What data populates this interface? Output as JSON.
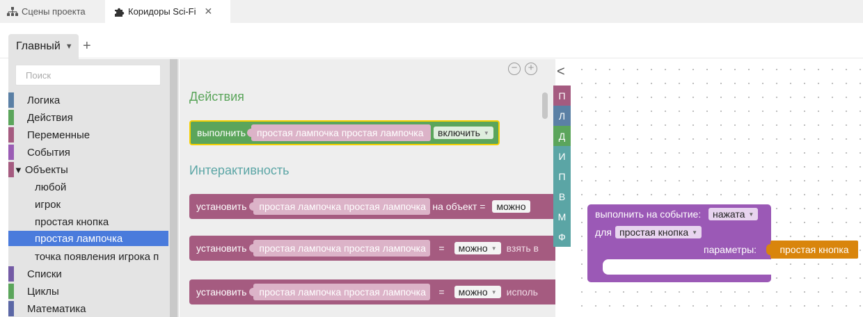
{
  "tabs": [
    {
      "label": "Сцены проекта",
      "icon": "sitemap-icon"
    },
    {
      "label": "Коридоры Sci-Fi",
      "icon": "puzzle-icon",
      "close": "✕"
    }
  ],
  "group_tab": {
    "label": "Главный",
    "add": "+"
  },
  "search": {
    "placeholder": "Поиск"
  },
  "categories": [
    {
      "label": "Логика",
      "color": "#5b80a5"
    },
    {
      "label": "Действия",
      "color": "#5ba55b"
    },
    {
      "label": "Переменные",
      "color": "#a55b80"
    },
    {
      "label": "События",
      "color": "#9a5cb4"
    },
    {
      "label": "Объекты",
      "color": "#a55b80",
      "expanded": "▼"
    },
    {
      "label": "любой"
    },
    {
      "label": "игрок"
    },
    {
      "label": "простая кнопка"
    },
    {
      "label": "простая лампочка",
      "selected": true
    },
    {
      "label": "точка появления игрока п"
    },
    {
      "label": "Списки",
      "color": "#745ba5"
    },
    {
      "label": "Циклы",
      "color": "#5ba55b"
    },
    {
      "label": "Математика",
      "color": "#5b67a5"
    }
  ],
  "flyout": {
    "zoom_out": "−",
    "zoom_in": "+",
    "sections": [
      {
        "label": "Действия",
        "color": "#5ba55b"
      },
      {
        "label": "Интерактивность",
        "color": "#5ba5a5"
      }
    ],
    "action_block": {
      "label": "выполнить",
      "target": "простая лампочка простая лампочка",
      "dropdown": "включить"
    },
    "set_blocks": [
      {
        "label": "установить",
        "target": "простая лампочка простая лампочка",
        "middle": "на объект =",
        "dropdown": "можно",
        "tail": ""
      },
      {
        "label": "установить",
        "target": "простая лампочка простая лампочка",
        "middle": "=",
        "dropdown": "можно",
        "tail": "взять в"
      },
      {
        "label": "установить",
        "target": "простая лампочка простая лампочка",
        "middle": "=",
        "dropdown": "можно",
        "tail": "исполь"
      }
    ]
  },
  "palette": {
    "collapse": "<",
    "letters": [
      {
        "label": "П",
        "color": "#a55b80"
      },
      {
        "label": "Л",
        "color": "#5b80a5"
      },
      {
        "label": "Д",
        "color": "#5ba55b"
      },
      {
        "label": "И",
        "color": "#5ba5a5"
      },
      {
        "label": "П",
        "color": "#5ba5a5"
      },
      {
        "label": "В",
        "color": "#5ba5a5"
      },
      {
        "label": "М",
        "color": "#5ba5a5"
      },
      {
        "label": "Ф",
        "color": "#5ba5a5"
      }
    ]
  },
  "workspace": {
    "event_block": {
      "line1": "выполнить на событие:",
      "event_dropdown": "нажата",
      "line2": "для",
      "object_dropdown": "простая кнопка",
      "params_label": "параметры:",
      "param_value": "простая кнопка"
    }
  },
  "colors": {
    "action_green": "#5ba55b",
    "object_pink": "#a55b80",
    "event_purple": "#9b59b6",
    "param_orange": "#d9850c",
    "selected_blue": "#4a7bdc",
    "highlight_yellow": "#f5d000"
  }
}
